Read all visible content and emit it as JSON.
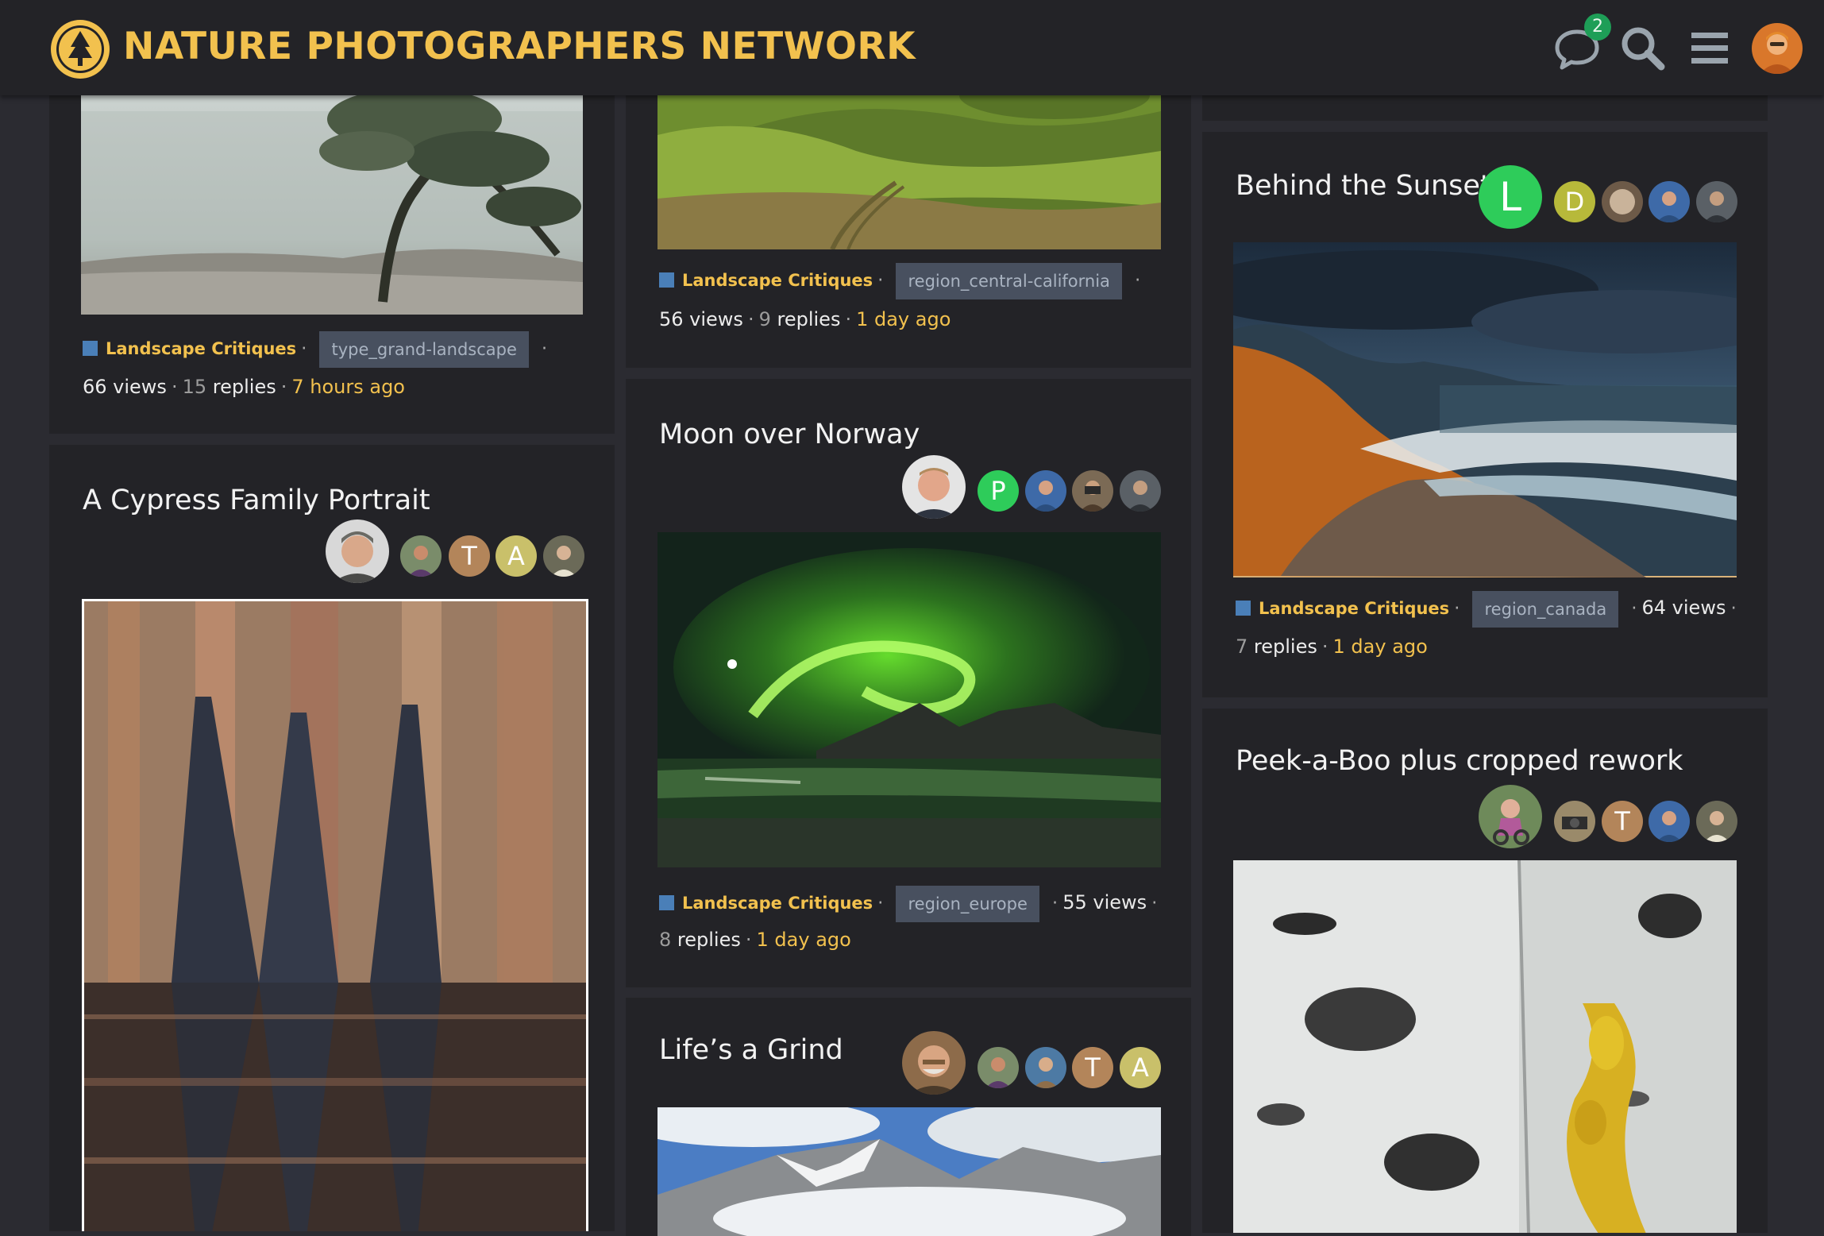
{
  "header": {
    "site_title": "NATURE PHOTOGRAPHERS NETWORK",
    "chat_badge_count": "2",
    "icons": [
      "logo-icon",
      "chat-icon",
      "search-icon",
      "menu-icon",
      "user-avatar"
    ],
    "accent_color": "#f2c14e"
  },
  "cards": {
    "pine": {
      "category": "Landscape Critiques",
      "tag": "type_grand-landscape",
      "views": "66 views",
      "replies_count": "15",
      "replies_label": "replies",
      "ago": "7 hours ago"
    },
    "hills": {
      "category": "Landscape Critiques",
      "tag": "region_central-california",
      "views": "56 views",
      "replies_count": "9",
      "replies_label": "replies",
      "ago": "1 day ago"
    },
    "cypress": {
      "title": "A Cypress Family Portrait",
      "letters": [
        "T",
        "A"
      ]
    },
    "moon": {
      "title": "Moon over Norway",
      "letters": [
        "P"
      ],
      "category": "Landscape Critiques",
      "tag": "region_europe",
      "views": "55 views",
      "replies_count": "8",
      "replies_label": "replies",
      "ago": "1 day ago"
    },
    "grind": {
      "title": "Life’s a Grind",
      "letters": [
        "T",
        "A"
      ]
    },
    "sunset": {
      "title": "Behind the Sunset",
      "letters": [
        "L",
        "D"
      ],
      "category": "Landscape Critiques",
      "tag": "region_canada",
      "views": "64 views",
      "replies_count": "7",
      "replies_label": "replies",
      "ago": "1 day ago"
    },
    "peek": {
      "title": "Peek-a-Boo plus cropped rework",
      "letters": [
        "T"
      ]
    }
  },
  "separator": "·"
}
